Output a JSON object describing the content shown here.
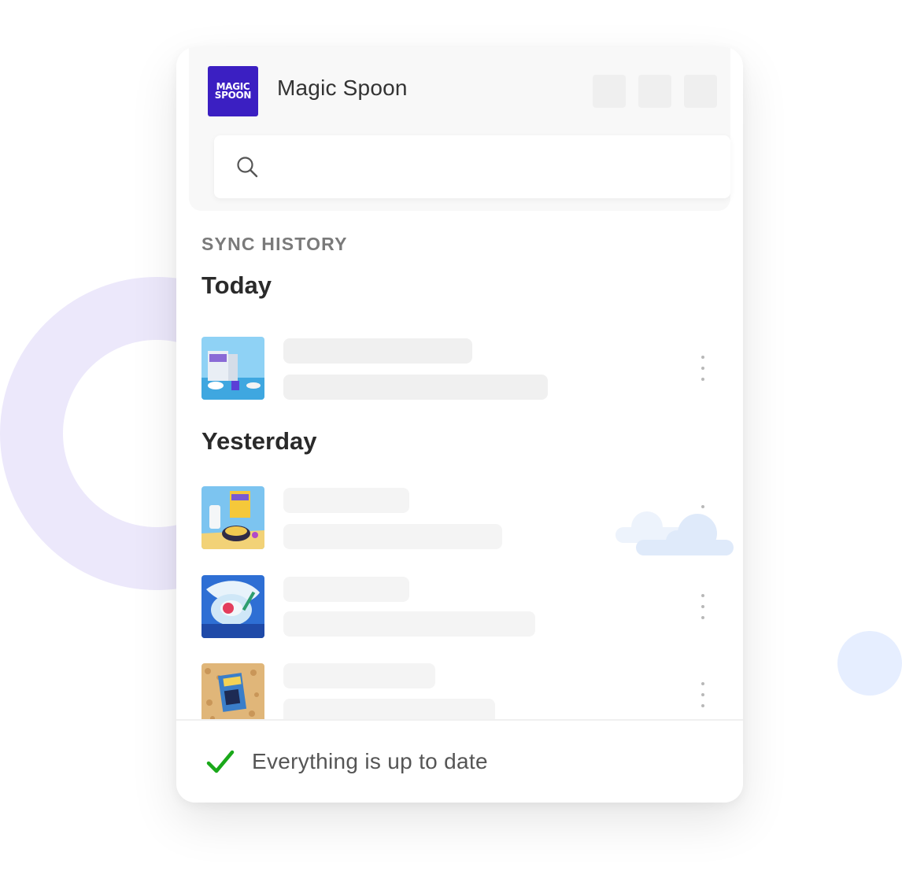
{
  "app": {
    "logo_line1": "MAGIC",
    "logo_line2": "SPOON",
    "title": "Magic Spoon",
    "brand_color": "#3b1fc2"
  },
  "search": {
    "placeholder": "",
    "icon": "search-icon"
  },
  "sync_history": {
    "label": "SYNC HISTORY",
    "groups": [
      {
        "heading": "Today",
        "items": [
          {
            "thumbnail": "cereal-box-blue-scene"
          }
        ]
      },
      {
        "heading": "Yesterday",
        "items": [
          {
            "thumbnail": "cereal-bowl-yellow-scene"
          },
          {
            "thumbnail": "cereal-bowl-splash-scene"
          },
          {
            "thumbnail": "cereal-box-on-grains-scene"
          }
        ]
      }
    ]
  },
  "status": {
    "text": "Everything is up to date",
    "icon": "check-icon",
    "color": "#1aa81a"
  },
  "decor": {
    "ring_color": "#ece8fb",
    "dot_color": "#e6eeff",
    "cloud_color": "#e3edfb"
  }
}
